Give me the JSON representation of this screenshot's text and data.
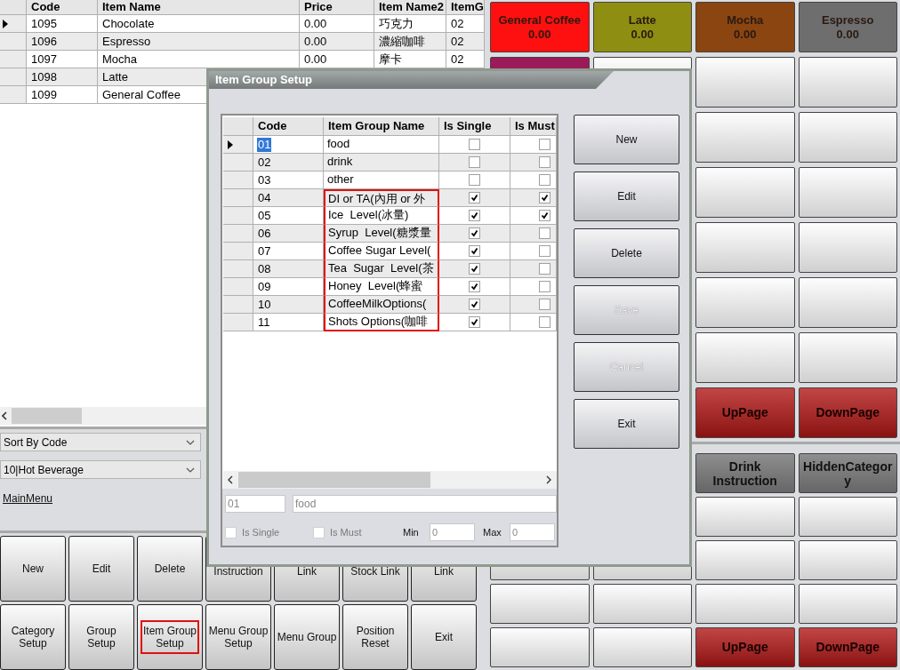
{
  "item_table": {
    "columns": [
      "Code",
      "Item Name",
      "Price",
      "Item Name2",
      "ItemG"
    ],
    "rows": [
      {
        "cells": [
          "1095",
          "Chocolate",
          "0.00",
          "巧克力",
          "02"
        ],
        "selected": true
      },
      {
        "cells": [
          "1096",
          "Espresso",
          "0.00",
          "濃縮咖啡",
          "02"
        ],
        "selected": false
      },
      {
        "cells": [
          "1097",
          "Mocha",
          "0.00",
          "摩卡",
          "02"
        ],
        "selected": false
      },
      {
        "cells": [
          "1098",
          "Latte"
        ],
        "selected": false
      },
      {
        "cells": [
          "1099",
          "General Coffee"
        ],
        "selected": false
      }
    ]
  },
  "sort_dropdown": {
    "value": "Sort By Code"
  },
  "category_dropdown": {
    "value": "10|Hot Beverage"
  },
  "main_menu_link": "MainMenu",
  "bottom_buttons": [
    {
      "label": "New",
      "covered": false,
      "outlined": false
    },
    {
      "label": "Edit",
      "covered": false,
      "outlined": false
    },
    {
      "label": "Delete",
      "covered": false,
      "outlined": false
    },
    {
      "label": "Instruction",
      "covered": true,
      "outlined": false
    },
    {
      "label": "Link",
      "covered": true,
      "outlined": false
    },
    {
      "label": "Stock Link",
      "covered": true,
      "outlined": false
    },
    {
      "label": "Link",
      "covered": true,
      "outlined": false
    },
    {
      "label": "Category Setup",
      "covered": false,
      "outlined": false
    },
    {
      "label": "Group Setup",
      "covered": false,
      "outlined": false
    },
    {
      "label": "Item Group Setup",
      "covered": false,
      "outlined": true
    },
    {
      "label": "Menu Group Setup",
      "covered": false,
      "outlined": false
    },
    {
      "label": "Menu Group",
      "covered": false,
      "outlined": false
    },
    {
      "label": "Position Reset",
      "covered": false,
      "outlined": false
    },
    {
      "label": "Exit",
      "covered": false,
      "outlined": false
    }
  ],
  "menu_items": [
    {
      "label": "General Coffee",
      "price": "0.00",
      "color": "#ff1010"
    },
    {
      "label": "Latte",
      "price": "0.00",
      "color": "#8e8e12"
    },
    {
      "label": "Mocha",
      "price": "0.00",
      "color": "#8a4510"
    },
    {
      "label": "Espresso",
      "price": "0.00",
      "color": "#6e6e6e"
    },
    {
      "color": "#9c1a5a"
    }
  ],
  "menu_pager": [
    "UpPage",
    "DownPage"
  ],
  "categories": [
    {
      "label": "Drink Instruction"
    },
    {
      "label": "HiddenCategory"
    }
  ],
  "category_pager": [
    "UpPage",
    "DownPage"
  ],
  "dialog": {
    "title": "Item Group Setup",
    "columns": [
      "Code",
      "Item Group Name",
      "Is Single",
      "Is Must"
    ],
    "rows": [
      {
        "code": "01",
        "name": "food",
        "is_single": false,
        "is_must": false,
        "selected": true,
        "outlined": false
      },
      {
        "code": "02",
        "name": "drink",
        "is_single": false,
        "is_must": false,
        "selected": false,
        "outlined": false
      },
      {
        "code": "03",
        "name": "other",
        "is_single": false,
        "is_must": false,
        "selected": false,
        "outlined": false
      },
      {
        "code": "04",
        "name": "DI or TA(內用 or 外",
        "is_single": true,
        "is_must": true,
        "selected": false,
        "outlined": true
      },
      {
        "code": "05",
        "name": "Ice  Level(冰量)",
        "is_single": true,
        "is_must": true,
        "selected": false,
        "outlined": true
      },
      {
        "code": "06",
        "name": "Syrup  Level(糖漿量",
        "is_single": true,
        "is_must": false,
        "selected": false,
        "outlined": true
      },
      {
        "code": "07",
        "name": "Coffee Sugar Level(",
        "is_single": true,
        "is_must": false,
        "selected": false,
        "outlined": true
      },
      {
        "code": "08",
        "name": "Tea  Sugar  Level(茶",
        "is_single": true,
        "is_must": false,
        "selected": false,
        "outlined": true
      },
      {
        "code": "09",
        "name": "Honey  Level(蜂蜜",
        "is_single": true,
        "is_must": false,
        "selected": false,
        "outlined": true
      },
      {
        "code": "10",
        "name": "CoffeeMilkOptions(",
        "is_single": true,
        "is_must": false,
        "selected": false,
        "outlined": true
      },
      {
        "code": "11",
        "name": "Shots Options(咖啡",
        "is_single": true,
        "is_must": false,
        "selected": false,
        "outlined": true
      }
    ],
    "code_field": "01",
    "name_field": "food",
    "is_single": {
      "label": "Is Single",
      "checked": false
    },
    "is_must": {
      "label": "Is Must",
      "checked": false
    },
    "min": {
      "label": "Min",
      "value": "0"
    },
    "max": {
      "label": "Max",
      "value": "0"
    },
    "buttons": [
      {
        "label": "New",
        "disabled": false
      },
      {
        "label": "Edit",
        "disabled": false
      },
      {
        "label": "Delete",
        "disabled": false
      },
      {
        "label": "Save",
        "disabled": true
      },
      {
        "label": "Cancel",
        "disabled": true
      },
      {
        "label": "Exit",
        "disabled": false
      }
    ]
  }
}
